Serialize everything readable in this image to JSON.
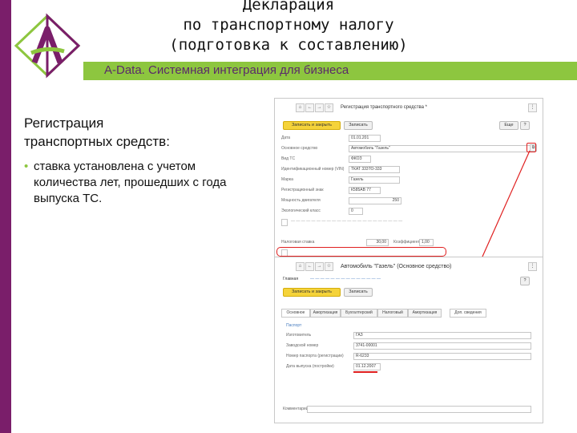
{
  "header": {
    "title_line1": "Декларация",
    "title_line2": "по транспортному налогу",
    "title_line3": "(подготовка к составлению)",
    "subtitle": "A-Data. Системная интеграция для бизнеса"
  },
  "slide": {
    "heading": "Регистрация транспортных средств:",
    "heading_line1": "Регистрация",
    "heading_line2": "транспортных средств:",
    "bullet": "ставка установлена с учетом количества лет, прошедших с года выпуска ТС."
  },
  "window1": {
    "title": "Регистрация транспортного средства *",
    "save_close": "Записать и закрыть",
    "write": "Записать",
    "more": "Еще",
    "help": "?",
    "fields": [
      {
        "label": "Дата",
        "value": "01.01.201"
      },
      {
        "label": "Основное средство",
        "value": "Автомобиль \"Газель\""
      },
      {
        "label": "Вид ТС",
        "value": "ФКОЗ"
      },
      {
        "label": "Идентификационный номер (VIN)",
        "value": "ТКАТ 333ТО-333"
      },
      {
        "label": "Марка",
        "value": "Газель"
      },
      {
        "label": "Регистрационный знак",
        "value": "К585АВ 77"
      },
      {
        "label": "Мощность двигателя",
        "value": "250"
      },
      {
        "label": "Экологический класс",
        "value": "0"
      },
      {
        "label": "Налоговая ставка",
        "value": "30,00"
      },
      {
        "label": "Коэффициент",
        "value": "1,00"
      }
    ]
  },
  "window2": {
    "title": "Автомобиль \"Газель\" (Основное средство)",
    "main_link": "Главная",
    "save_close": "Записать и закрыть",
    "write": "Записать",
    "help": "?",
    "tabs": [
      "Основное",
      "Амортизация",
      "Бухгалтерский",
      "Налоговый",
      "Амортизация",
      "Доп. сведения"
    ],
    "section": "Паспорт",
    "fields": [
      {
        "label": "Изготовитель",
        "value": "ГАЗ"
      },
      {
        "label": "Заводской номер",
        "value": "3741-00001"
      },
      {
        "label": "Номер паспорта (регистрации)",
        "value": "R-6233"
      },
      {
        "label": "Дата выпуска (постройки)",
        "value": "01.12.2007"
      }
    ],
    "comment_label": "Комментарий"
  },
  "colors": {
    "purple": "#7a1e6a",
    "green": "#8dc63f",
    "highlight": "#e02020",
    "button_yellow": "#f5d33a"
  }
}
